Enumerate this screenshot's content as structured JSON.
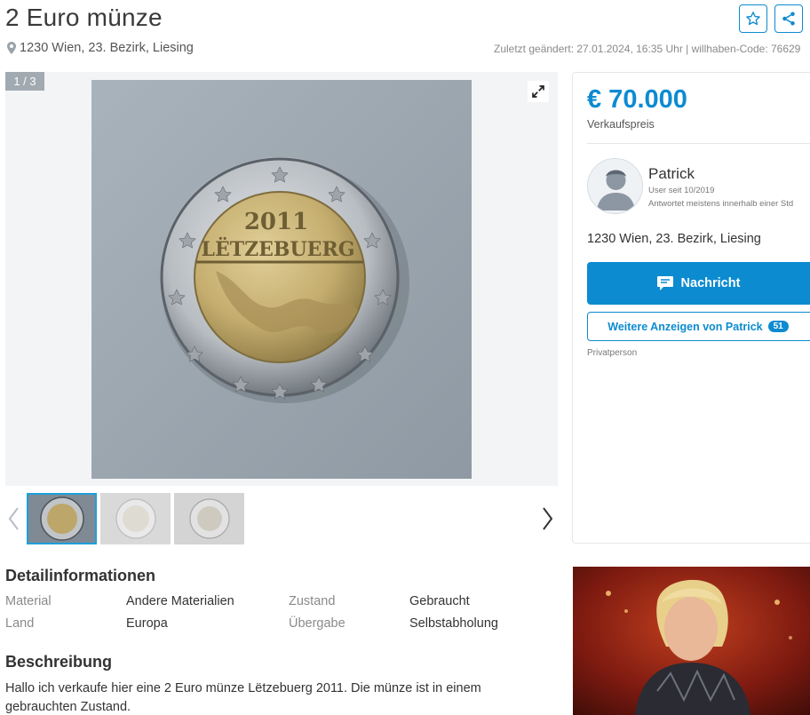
{
  "listing": {
    "title": "2 Euro münze",
    "location": "1230 Wien, 23. Bezirk, Liesing",
    "meta": "Zuletzt geändert: 27.01.2024, 16:35 Uhr | willhaben-Code: 76629"
  },
  "gallery": {
    "counter": "1 / 3",
    "coin_text_year": "2011",
    "coin_text_name": "LËTZEBUERG"
  },
  "price_card": {
    "price": "€ 70.000",
    "price_label": "Verkaufspreis",
    "seller_name": "Patrick",
    "seller_since": "User seit 10/2019",
    "seller_reply": "Antwortet meistens innerhalb einer Std",
    "seller_location": "1230 Wien, 23. Bezirk, Liesing",
    "message_button": "Nachricht",
    "more_ads_button": "Weitere Anzeigen von Patrick",
    "more_ads_count": "51",
    "seller_type": "Privatperson"
  },
  "details": {
    "heading": "Detailinformationen",
    "rows": [
      {
        "k1": "Material",
        "v1": "Andere Materialien",
        "k2": "Zustand",
        "v2": "Gebraucht"
      },
      {
        "k1": "Land",
        "v1": "Europa",
        "k2": "Übergabe",
        "v2": "Selbstabholung"
      }
    ]
  },
  "description": {
    "heading": "Beschreibung",
    "text": "Hallo ich verkaufe hier eine 2 Euro münze Lëtzebuerg 2011. Die münze ist in einem gebrauchten Zustand."
  },
  "icons": {
    "favorite": "star-icon",
    "share": "share-icon",
    "expand": "expand-icon",
    "location": "map-pin-icon",
    "message": "chat-bubble-icon"
  },
  "colors": {
    "accent": "#0c8bd0",
    "text": "#333333",
    "muted": "#8a8a8a"
  }
}
